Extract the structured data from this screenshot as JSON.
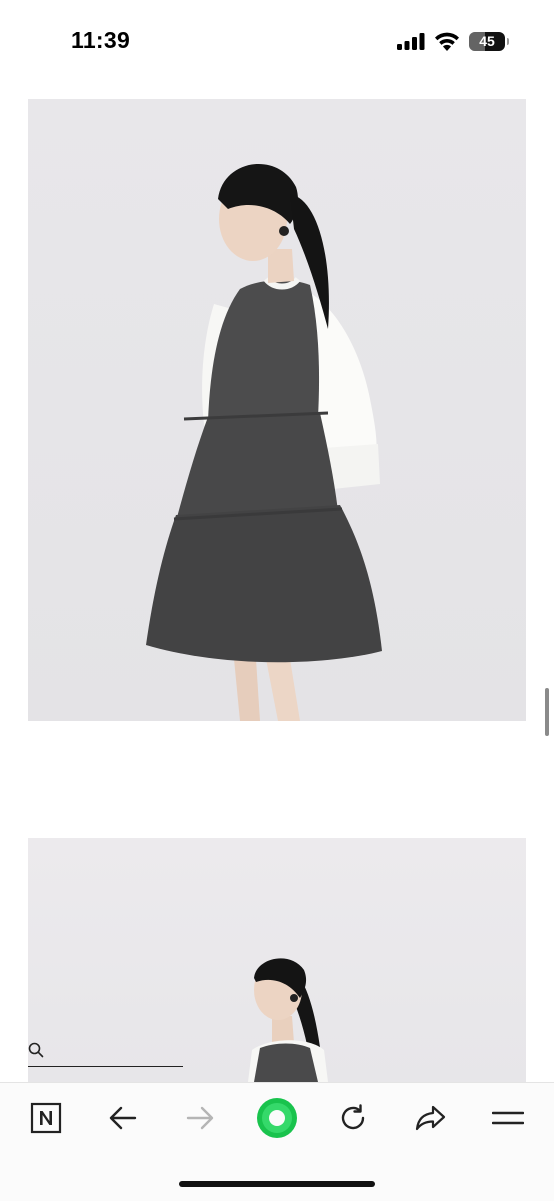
{
  "status_bar": {
    "time": "11:39",
    "battery_level": "45",
    "battery_fraction": 0.45
  },
  "photos": [
    {
      "icon": "product-photo-full-length"
    },
    {
      "icon": "product-photo-side-profile"
    }
  ],
  "search": {
    "icon": "search-icon"
  },
  "browser_toolbar": {
    "items": [
      "naver-n-icon",
      "back-arrow-icon",
      "forward-arrow-icon",
      "green-home-icon",
      "reload-icon",
      "share-icon",
      "menu-icon"
    ],
    "accent_color": "#19c34d"
  }
}
